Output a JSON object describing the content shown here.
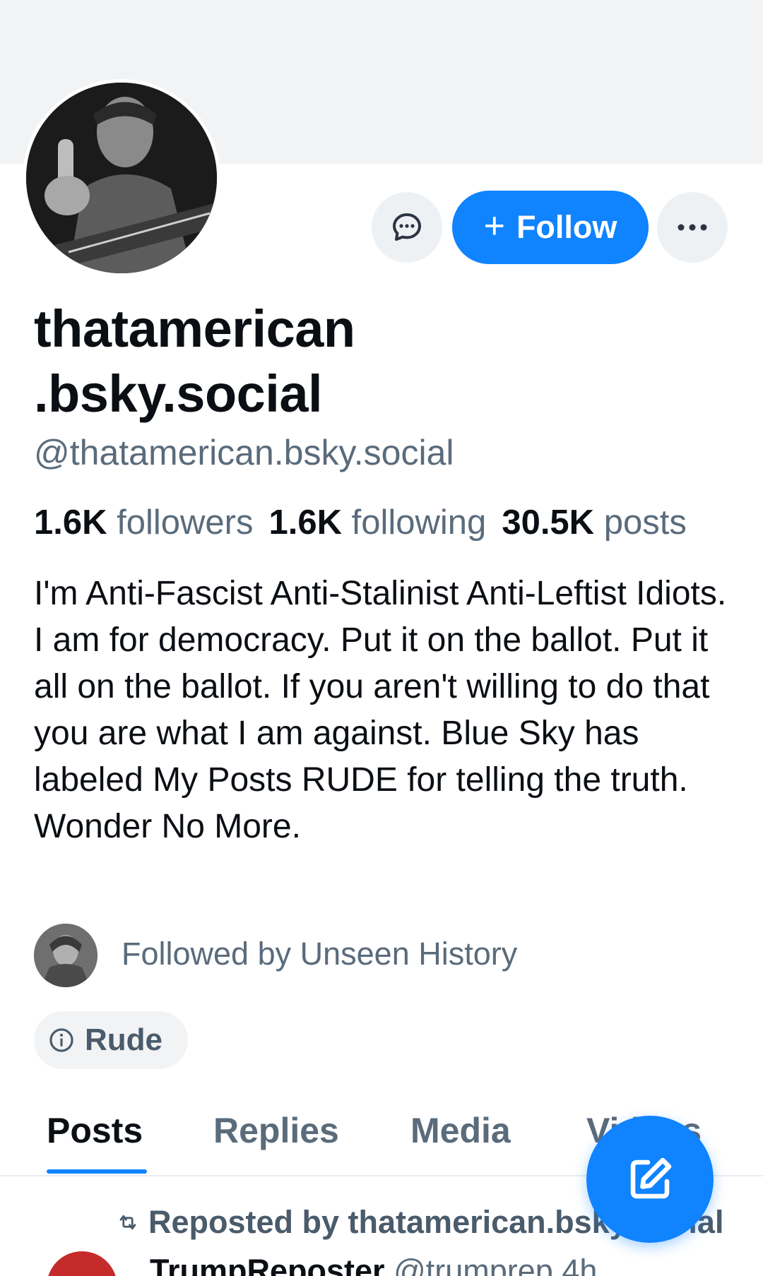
{
  "profile": {
    "display_name_line1": "thatamerican",
    "display_name_line2": ".bsky.social",
    "handle": "@thatamerican.bsky.social",
    "stats": {
      "followers_count": "1.6K",
      "followers_label": "followers",
      "following_count": "1.6K",
      "following_label": "following",
      "posts_count": "30.5K",
      "posts_label": "posts"
    },
    "bio": "I'm Anti-Fascist Anti-Stalinist Anti-Leftist Idiots. I am for democracy. Put it on the ballot. Put it all on the ballot. If you aren't willing to do that you are what I am against. Blue Sky has labeled My Posts RUDE for telling the truth. Wonder No More.",
    "followed_by": "Followed by Unseen History",
    "label": "Rude"
  },
  "actions": {
    "follow_label": "Follow",
    "follow_plus": "+",
    "message_icon": "chat-bubble-icon",
    "more_icon": "ellipsis-icon"
  },
  "tabs": [
    "Posts",
    "Replies",
    "Media",
    "Videos"
  ],
  "active_tab": "Posts",
  "feed": {
    "repost_text": "Reposted by thatamerican.bsky.social",
    "author_name": "TrumpReposter",
    "author_handle": "@trumprep",
    "post_age": "4h"
  },
  "colors": {
    "accent": "#1083fe",
    "muted_text": "#5a6b7b",
    "banner": "#f1f3f5"
  }
}
